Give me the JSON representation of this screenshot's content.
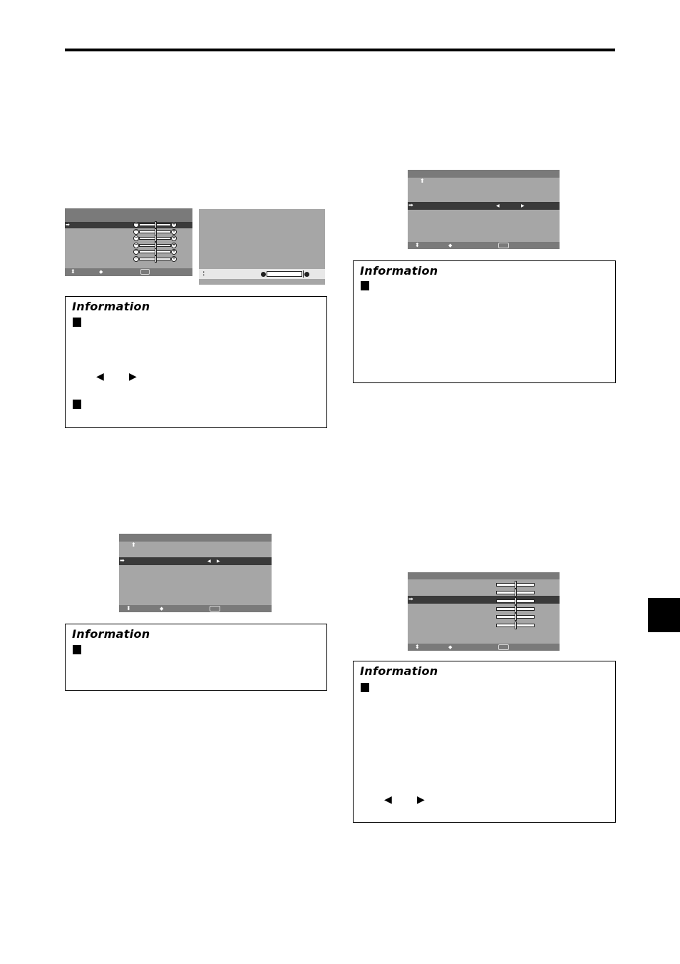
{
  "page": {
    "section_tab": "",
    "top_rule": true
  },
  "screens": {
    "picture_menu": {
      "title": "",
      "rows": [
        {
          "label": "",
          "slider_value": 0.5,
          "selected": true
        },
        {
          "label": "",
          "slider_value": 0.5,
          "selected": false
        },
        {
          "label": "",
          "slider_value": 0.5,
          "selected": false
        },
        {
          "label": "",
          "slider_value": 0.5,
          "selected": false
        },
        {
          "label": "",
          "slider_value": 0.5,
          "selected": false
        },
        {
          "label": "",
          "slider_value": 0.5,
          "selected": false
        }
      ],
      "footer": {
        "select_icon": "up-down-icon",
        "adjust_icon": "left-right-icon",
        "exit_icon": "exit-box-icon"
      }
    },
    "adjust_bar_screen": {
      "slider_value": 0.0,
      "footer_icon": "up-down-small-icon"
    },
    "top_right_menu": {
      "back_icon": "up-arrow-icon",
      "selected_row": {
        "arrow_icon": "right-arrow-icon",
        "left_icon": "left-triangle-icon",
        "right_icon": "right-triangle-icon"
      },
      "footer": {
        "select_icon": "up-down-icon",
        "adjust_icon": "left-right-icon",
        "exit_icon": "exit-box-icon"
      }
    },
    "mid_left_menu": {
      "back_icon": "up-arrow-icon",
      "selected_row": {
        "arrow_icon": "right-arrow-icon",
        "left_icon": "left-triangle-icon",
        "right_icon": "right-triangle-icon"
      },
      "footer": {
        "select_icon": "up-down-icon",
        "adjust_icon": "left-right-icon",
        "exit_icon": "exit-box-icon"
      }
    },
    "bottom_right_menu": {
      "rows": [
        {
          "slider_value": 0.5,
          "selected": false
        },
        {
          "slider_value": 0.5,
          "selected": false
        },
        {
          "slider_value": 0.5,
          "selected": true
        },
        {
          "slider_value": 0.5,
          "selected": false
        },
        {
          "slider_value": 0.5,
          "selected": false
        },
        {
          "slider_value": 0.5,
          "selected": false
        }
      ],
      "footer": {
        "select_icon": "up-down-icon",
        "adjust_icon": "left-right-icon",
        "exit_icon": "exit-box-icon"
      }
    }
  },
  "info_boxes": [
    {
      "title": "Information",
      "bullets": 2,
      "arrows": [
        "◀",
        "▶"
      ]
    },
    {
      "title": "Information",
      "bullets": 1,
      "arrows": []
    },
    {
      "title": "Information",
      "bullets": 1,
      "arrows": []
    },
    {
      "title": "Information",
      "bullets": 1,
      "arrows": [
        "◀",
        "▶"
      ]
    }
  ],
  "glyphs": {
    "up_arrow": "⬆",
    "right_arrow": "➡",
    "left_tri": "◀",
    "right_tri": "▶",
    "up_down": "⬍",
    "left_right": "◆",
    "minus": "−",
    "plus": "+",
    "colon_dots": ":"
  }
}
